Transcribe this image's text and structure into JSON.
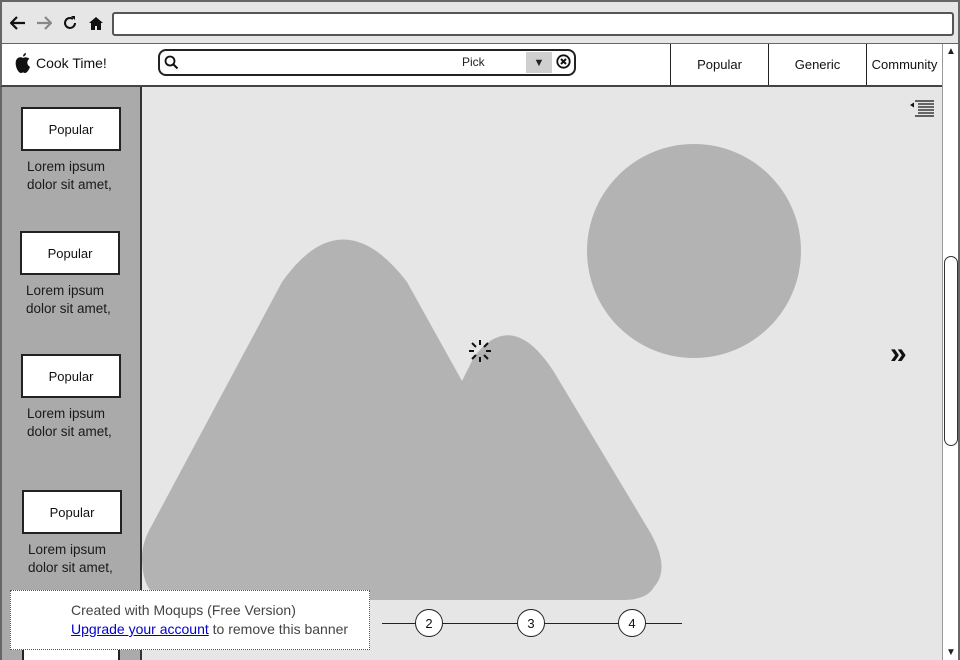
{
  "app": {
    "name": "Cook Time!",
    "logo_icon": "apple-icon"
  },
  "search": {
    "placeholder": "",
    "value": "",
    "pick_label": "Pick"
  },
  "nav": {
    "tabs": [
      {
        "label": "Popular"
      },
      {
        "label": "Generic"
      },
      {
        "label": "Community"
      }
    ]
  },
  "sidebar": {
    "items": [
      {
        "button": "Popular",
        "text": "Lorem ipsum dolor sit amet,"
      },
      {
        "button": "Popular",
        "text": "Lorem ipsum dolor sit amet,"
      },
      {
        "button": "Popular",
        "text": "Lorem ipsum dolor sit amet,"
      },
      {
        "button": "Popular",
        "text": "Lorem ipsum dolor sit amet,"
      }
    ]
  },
  "carousel": {
    "pages": [
      "2",
      "3",
      "4"
    ]
  },
  "banner": {
    "line1": "Created with Moqups (Free Version)",
    "link": "Upgrade your account",
    "line2_rest": " to remove this banner"
  },
  "colors": {
    "image_bg": "#e6e6e6",
    "image_shape": "#b3b3b3",
    "sidebar_bg": "#aaaaaa"
  }
}
